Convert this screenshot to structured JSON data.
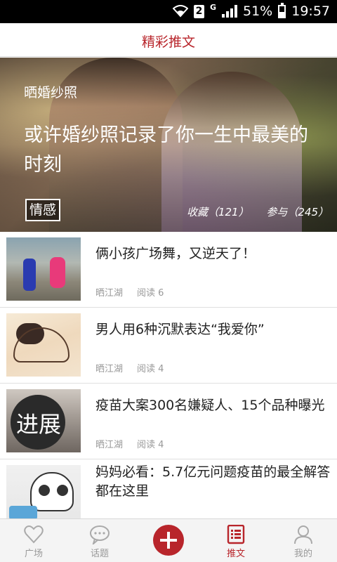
{
  "status_bar": {
    "sim_label": "2",
    "network_label": "G",
    "battery_percent": "51%",
    "time": "19:57"
  },
  "header": {
    "title": "精彩推文"
  },
  "hero": {
    "subtitle": "晒婚纱照",
    "title": "或许婚纱照记录了你一生中最美的时刻",
    "tag": "情感",
    "favorites": "收藏（121）",
    "participants": "参与（245）"
  },
  "articles": [
    {
      "title": "俩小孩广场舞，又逆天了！",
      "author": "晒江湖",
      "views": "阅读 6"
    },
    {
      "title": "男人用6种沉默表达“我爱你”",
      "author": "晒江湖",
      "views": "阅读 4"
    },
    {
      "title": "疫苗大案300名嫌疑人、15个品种曝光",
      "author": "晒江湖",
      "views": "阅读 4"
    },
    {
      "title": "妈妈必看：5.7亿元问题疫苗的最全解答 都在这里",
      "author": "",
      "views": ""
    }
  ],
  "thumb_text": {
    "progress": "进展"
  },
  "tabbar": {
    "items": [
      {
        "label": "广场",
        "icon": "heart-icon"
      },
      {
        "label": "话题",
        "icon": "chat-icon"
      },
      {
        "label": "",
        "icon": "plus-icon"
      },
      {
        "label": "推文",
        "icon": "list-icon"
      },
      {
        "label": "我的",
        "icon": "user-icon"
      }
    ],
    "active_color": "#b8252b"
  }
}
